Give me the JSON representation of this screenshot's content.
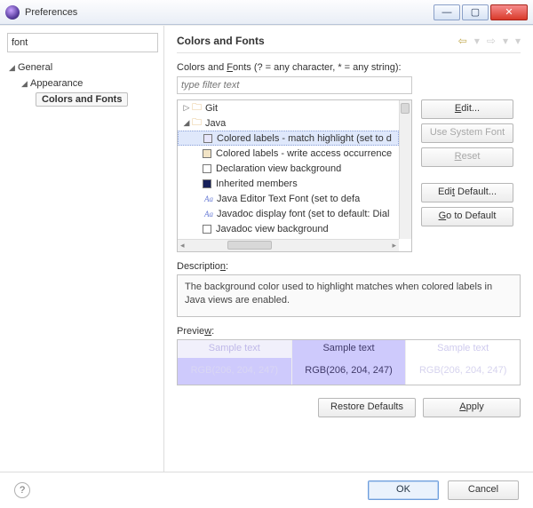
{
  "window": {
    "title": "Preferences"
  },
  "left": {
    "search_value": "font",
    "tree": {
      "root": "General",
      "child1": "Appearance",
      "child2": "Colors and Fonts"
    }
  },
  "page": {
    "title": "Colors and Fonts",
    "filter_label": "Colors and Fonts (? = any character, * = any string):",
    "filter_placeholder": "type filter text",
    "items": {
      "git": "Git",
      "java": "Java",
      "i0": "Colored labels - match highlight (set to d",
      "i1": "Colored labels - write access occurrence",
      "i2": "Declaration view background",
      "i3": "Inherited members",
      "i4": "Java Editor Text Font (set to defa",
      "i5": "Javadoc display font (set to default: Dial",
      "i6": "Javadoc view background"
    },
    "buttons": {
      "edit": "Edit...",
      "use_system": "Use System Font",
      "reset": "Reset",
      "edit_default": "Edit Default...",
      "go_default": "Go to Default"
    },
    "description_label": "Description:",
    "description_text": "The background color used to highlight matches when colored labels in Java views are enabled.",
    "preview_label": "Preview:",
    "preview": {
      "sample": "Sample text",
      "rgb": "RGB(206, 204, 247)"
    },
    "restore": "Restore Defaults",
    "apply": "Apply"
  },
  "footer": {
    "ok": "OK",
    "cancel": "Cancel"
  }
}
